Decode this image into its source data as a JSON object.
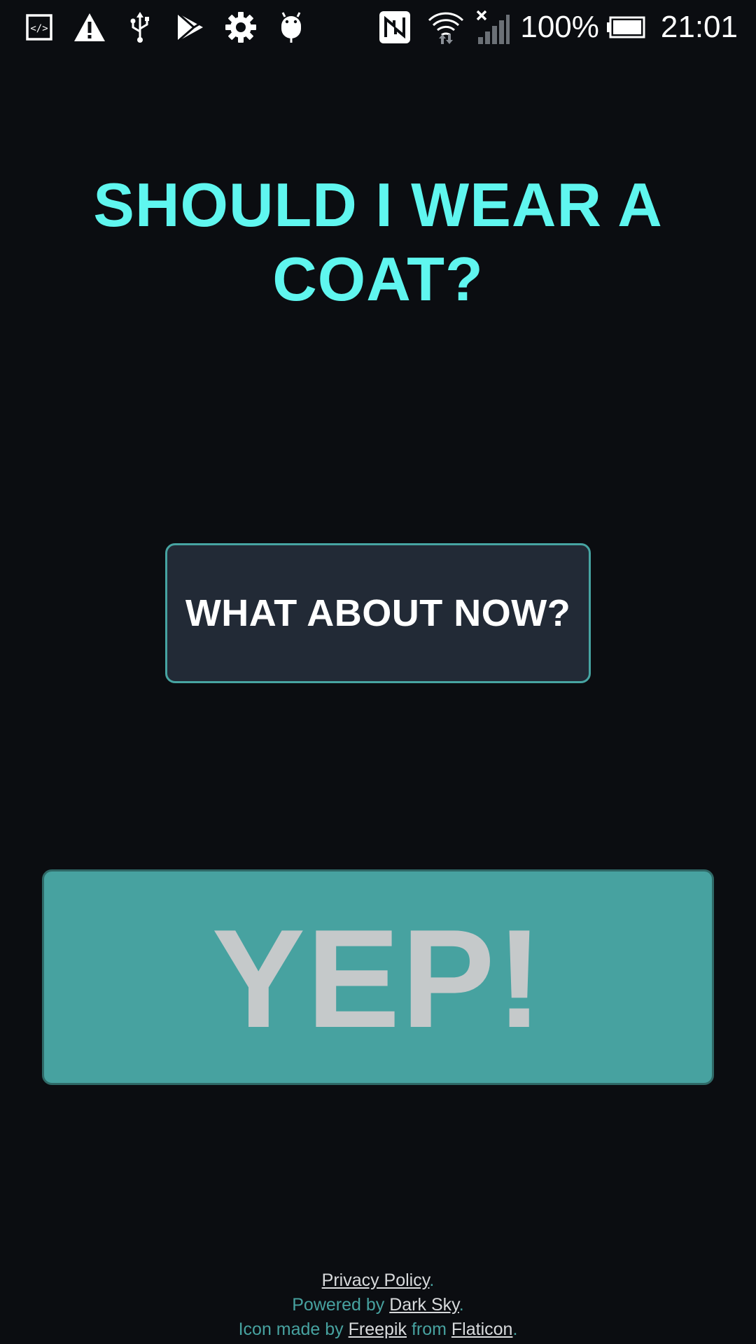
{
  "status_bar": {
    "left_icons": [
      "code-icon",
      "warning-icon",
      "usb-icon",
      "play-store-icon",
      "settings-icon",
      "android-debug-icon"
    ],
    "right_icons": [
      "nfc-icon",
      "wifi-icon",
      "signal-icon",
      "battery-icon"
    ],
    "battery_percent": "100%",
    "time": "21:01"
  },
  "main": {
    "headline": "SHOULD I WEAR A COAT?",
    "check_button_label": "WHAT ABOUT NOW?",
    "answer": "YEP!"
  },
  "footer": {
    "privacy_link": "Privacy Policy",
    "privacy_suffix": ".",
    "powered_prefix": "Powered by ",
    "powered_link": "Dark Sky",
    "powered_suffix": ".",
    "icon_prefix": "Icon made by ",
    "icon_author_link": "Freepik",
    "icon_from": " from ",
    "icon_source_link": "Flaticon",
    "icon_suffix": "."
  },
  "colors": {
    "background": "#0b0d11",
    "headline": "#5ff6ef",
    "button_bg": "#222a36",
    "button_border": "#47a4a2",
    "answer_bg": "#47a2a0",
    "answer_text": "#c5c9ca",
    "footer_text": "#47a2a0"
  }
}
